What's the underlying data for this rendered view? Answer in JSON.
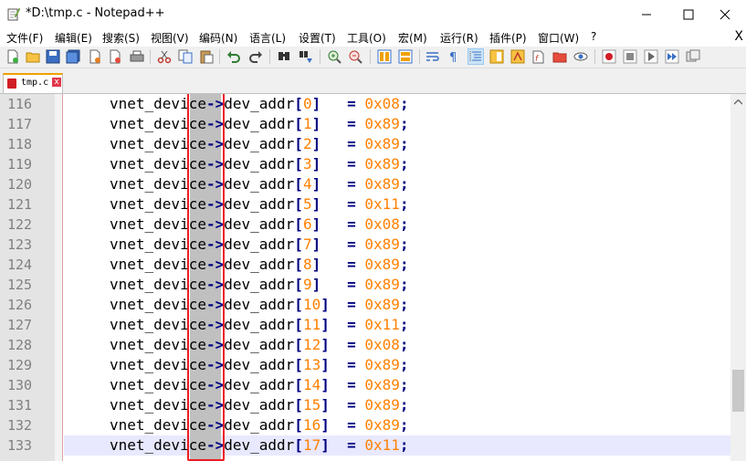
{
  "window": {
    "title": "*D:\\tmp.c - Notepad++"
  },
  "menu": [
    "文件(F)",
    "编辑(E)",
    "搜索(S)",
    "视图(V)",
    "编码(N)",
    "语言(L)",
    "设置(T)",
    "工具(O)",
    "宏(M)",
    "运行(R)",
    "插件(P)",
    "窗口(W)",
    "?"
  ],
  "menu_close": "X",
  "toolbar": {
    "icons": [
      "new-file-icon",
      "open-file-icon",
      "save-icon",
      "save-all-icon",
      "close-icon",
      "close-all-icon",
      "print-icon",
      "cut-icon",
      "copy-icon",
      "paste-icon",
      "undo-icon",
      "redo-icon",
      "find-icon",
      "replace-icon",
      "zoom-in-icon",
      "zoom-out-icon",
      "sync-vertical-icon",
      "sync-horizontal-icon",
      "word-wrap-icon",
      "show-all-chars-icon",
      "indent-guide-icon",
      "document-map-icon",
      "function-list-icon",
      "folder-workspace-icon",
      "monitor-icon",
      "record-macro-icon",
      "stop-macro-icon",
      "play-macro-icon",
      "run-macro-multiple-icon",
      "save-macro-icon"
    ]
  },
  "tab": {
    "label": "tmp.c",
    "close": "x"
  },
  "code": {
    "lines": [
      {
        "num": "116",
        "var": "vnet_device",
        "arrow": "->",
        "field": "dev_addr",
        "lb": "[",
        "idx": "0",
        "rb": "]",
        "pad": "  ",
        "eq": "=",
        "val": "0x08",
        "semi": ";"
      },
      {
        "num": "117",
        "var": "vnet_device",
        "arrow": "->",
        "field": "dev_addr",
        "lb": "[",
        "idx": "1",
        "rb": "]",
        "pad": "  ",
        "eq": "=",
        "val": "0x89",
        "semi": ";"
      },
      {
        "num": "118",
        "var": "vnet_device",
        "arrow": "->",
        "field": "dev_addr",
        "lb": "[",
        "idx": "2",
        "rb": "]",
        "pad": "  ",
        "eq": "=",
        "val": "0x89",
        "semi": ";"
      },
      {
        "num": "119",
        "var": "vnet_device",
        "arrow": "->",
        "field": "dev_addr",
        "lb": "[",
        "idx": "3",
        "rb": "]",
        "pad": "  ",
        "eq": "=",
        "val": "0x89",
        "semi": ";"
      },
      {
        "num": "120",
        "var": "vnet_device",
        "arrow": "->",
        "field": "dev_addr",
        "lb": "[",
        "idx": "4",
        "rb": "]",
        "pad": "  ",
        "eq": "=",
        "val": "0x89",
        "semi": ";"
      },
      {
        "num": "121",
        "var": "vnet_device",
        "arrow": "->",
        "field": "dev_addr",
        "lb": "[",
        "idx": "5",
        "rb": "]",
        "pad": "  ",
        "eq": "=",
        "val": "0x11",
        "semi": ";"
      },
      {
        "num": "122",
        "var": "vnet_device",
        "arrow": "->",
        "field": "dev_addr",
        "lb": "[",
        "idx": "6",
        "rb": "]",
        "pad": "  ",
        "eq": "=",
        "val": "0x08",
        "semi": ";"
      },
      {
        "num": "123",
        "var": "vnet_device",
        "arrow": "->",
        "field": "dev_addr",
        "lb": "[",
        "idx": "7",
        "rb": "]",
        "pad": "  ",
        "eq": "=",
        "val": "0x89",
        "semi": ";"
      },
      {
        "num": "124",
        "var": "vnet_device",
        "arrow": "->",
        "field": "dev_addr",
        "lb": "[",
        "idx": "8",
        "rb": "]",
        "pad": "  ",
        "eq": "=",
        "val": "0x89",
        "semi": ";"
      },
      {
        "num": "125",
        "var": "vnet_device",
        "arrow": "->",
        "field": "dev_addr",
        "lb": "[",
        "idx": "9",
        "rb": "]",
        "pad": "  ",
        "eq": "=",
        "val": "0x89",
        "semi": ";"
      },
      {
        "num": "126",
        "var": "vnet_device",
        "arrow": "->",
        "field": "dev_addr",
        "lb": "[",
        "idx": "10",
        "rb": "]",
        "pad": " ",
        "eq": "=",
        "val": "0x89",
        "semi": ";"
      },
      {
        "num": "127",
        "var": "vnet_device",
        "arrow": "->",
        "field": "dev_addr",
        "lb": "[",
        "idx": "11",
        "rb": "]",
        "pad": " ",
        "eq": "=",
        "val": "0x11",
        "semi": ";"
      },
      {
        "num": "128",
        "var": "vnet_device",
        "arrow": "->",
        "field": "dev_addr",
        "lb": "[",
        "idx": "12",
        "rb": "]",
        "pad": " ",
        "eq": "=",
        "val": "0x08",
        "semi": ";"
      },
      {
        "num": "129",
        "var": "vnet_device",
        "arrow": "->",
        "field": "dev_addr",
        "lb": "[",
        "idx": "13",
        "rb": "]",
        "pad": " ",
        "eq": "=",
        "val": "0x89",
        "semi": ";"
      },
      {
        "num": "130",
        "var": "vnet_device",
        "arrow": "->",
        "field": "dev_addr",
        "lb": "[",
        "idx": "14",
        "rb": "]",
        "pad": " ",
        "eq": "=",
        "val": "0x89",
        "semi": ";"
      },
      {
        "num": "131",
        "var": "vnet_device",
        "arrow": "->",
        "field": "dev_addr",
        "lb": "[",
        "idx": "15",
        "rb": "]",
        "pad": " ",
        "eq": "=",
        "val": "0x89",
        "semi": ";"
      },
      {
        "num": "132",
        "var": "vnet_device",
        "arrow": "->",
        "field": "dev_addr",
        "lb": "[",
        "idx": "16",
        "rb": "]",
        "pad": " ",
        "eq": "=",
        "val": "0x89",
        "semi": ";"
      },
      {
        "num": "133",
        "var": "vnet_device",
        "arrow": "->",
        "field": "dev_addr",
        "lb": "[",
        "idx": "17",
        "rb": "]",
        "pad": " ",
        "eq": "=",
        "val": "0x11",
        "semi": ";",
        "current": true
      }
    ]
  },
  "colors": {
    "keyword_operator": "#000080",
    "number": "#ff8000",
    "selection": "#c0c0c0",
    "annotation_box": "#ee1c24",
    "current_line": "#e8e8ff"
  }
}
